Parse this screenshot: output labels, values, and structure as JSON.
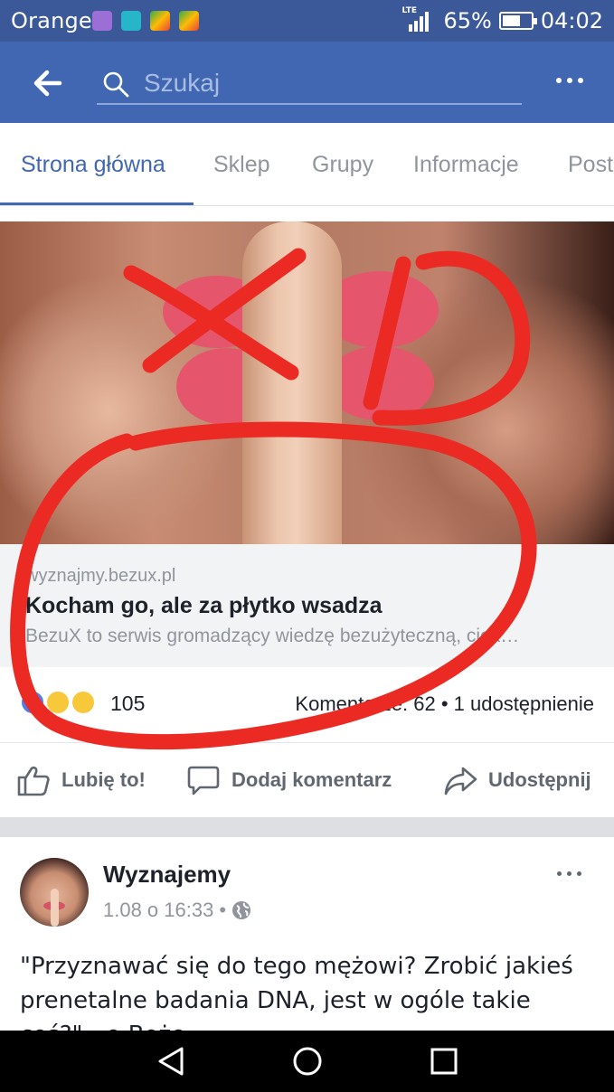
{
  "status_bar": {
    "carrier": "Orange",
    "network": "LTE",
    "battery": "65%",
    "battery_level": 0.65,
    "time": "04:02"
  },
  "header": {
    "search_placeholder": "Szukaj",
    "back_icon": "arrow-left-icon",
    "more_icon": "more-horizontal-icon"
  },
  "tabs": [
    {
      "label": "Strona główna",
      "active": true
    },
    {
      "label": "Sklep",
      "active": false
    },
    {
      "label": "Grupy",
      "active": false
    },
    {
      "label": "Informacje",
      "active": false
    },
    {
      "label": "Post",
      "active": false
    }
  ],
  "link_preview": {
    "domain": "wyznajmy.bezux.pl",
    "title": "Kocham go, ale za płytko wsadza",
    "description": "BezuX to serwis gromadzący wiedzę bezużyteczną, ciek…"
  },
  "reactions": {
    "count": "105",
    "stats": "Komentarze: 62 • 1 udostępnienie",
    "types": [
      "like",
      "haha",
      "sad"
    ]
  },
  "actions": {
    "like": "Lubię to!",
    "comment": "Dodaj komentarz",
    "share": "Udostępnij"
  },
  "post": {
    "page_name": "Wyznajemy",
    "timestamp": "1.08 o 16:33",
    "separator": "•",
    "text": "\"Przyznawać się do tego mężowi? Zrobić jakieś prenetalne badania DNA, jest w ogóle takie coś?\" - o Boże"
  },
  "colors": {
    "facebook_blue": "#4267b2",
    "status_blue": "#3b5998",
    "marker_red": "#ec2a24"
  }
}
